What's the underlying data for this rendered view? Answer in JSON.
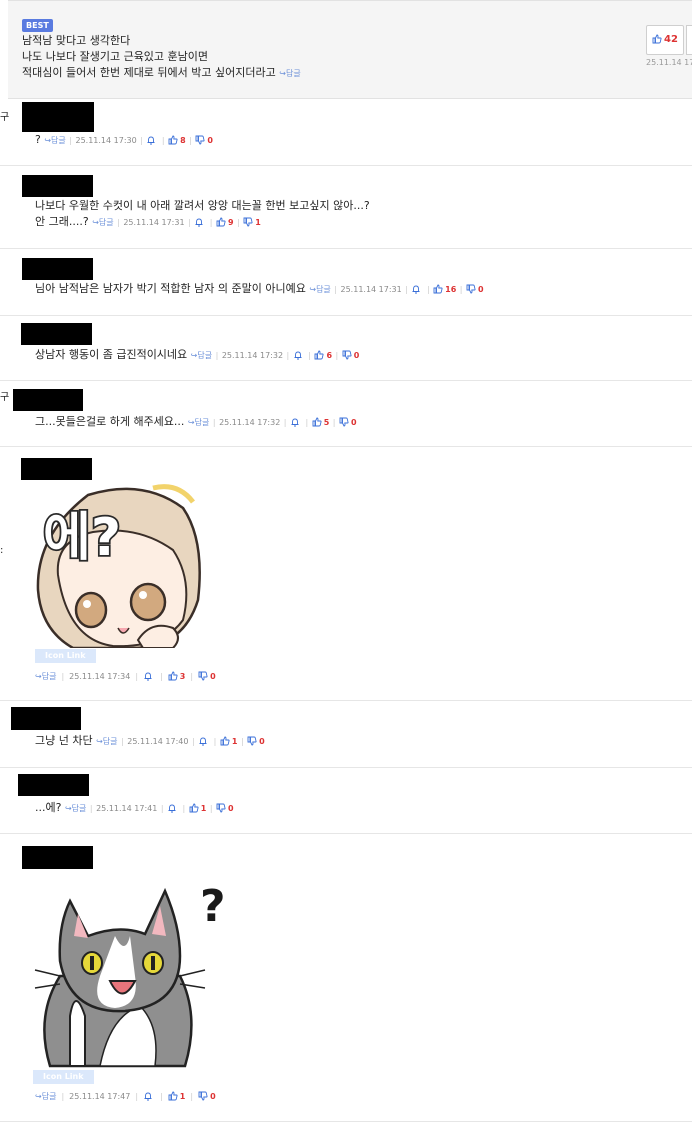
{
  "best": {
    "badge": "BEST",
    "lines": [
      "남적남 맞다고 생각한다",
      "나도 나보다 잘생기고 근육있고 훈남이면",
      "적대심이 들어서 한번 제대로 뒤에서 박고 싶어지더라고"
    ],
    "reply": "↪답글",
    "likes": "42",
    "date": "25.11.14 17"
  },
  "margin_glyphs": [
    "구",
    "구",
    ":"
  ],
  "comments": [
    {
      "lines": [
        "?"
      ],
      "reply": "↪답글",
      "date": "25.11.14 17:30",
      "likes": "8",
      "dislikes": "0"
    },
    {
      "lines": [
        "나보다 우월한 수컷이 내 아래 깔려서 앙앙 대는꼴 한번 보고싶지 않아...?",
        "안 그래....?"
      ],
      "reply": "↪답글",
      "date": "25.11.14 17:31",
      "likes": "9",
      "dislikes": "1"
    },
    {
      "lines": [
        "님아 남적남은 남자가 박기 적합한 남자 의 준말이 아니예요"
      ],
      "reply": "↪답글",
      "date": "25.11.14 17:31",
      "likes": "16",
      "dislikes": "0"
    },
    {
      "lines": [
        "상남자 행동이 좀 급진적이시네요"
      ],
      "reply": "↪답글",
      "date": "25.11.14 17:32",
      "likes": "6",
      "dislikes": "0"
    },
    {
      "lines": [
        "그...못들은걸로 하게 해주세요..."
      ],
      "reply": "↪답글",
      "date": "25.11.14 17:32",
      "likes": "5",
      "dislikes": "0"
    },
    {
      "sticker_text": "에?",
      "icon_link": "Icon Link",
      "reply": "↪답글",
      "date": "25.11.14 17:34",
      "likes": "3",
      "dislikes": "0"
    },
    {
      "lines": [
        "그냥 넌 차단"
      ],
      "reply": "↪답글",
      "date": "25.11.14 17:40",
      "likes": "1",
      "dislikes": "0"
    },
    {
      "lines": [
        "...에?"
      ],
      "reply": "↪답글",
      "date": "25.11.14 17:41",
      "likes": "1",
      "dislikes": "0"
    },
    {
      "sticker_text": "?",
      "icon_link": "Icon Link",
      "reply": "↪답글",
      "date": "25.11.14 17:47",
      "likes": "1",
      "dislikes": "0"
    }
  ]
}
